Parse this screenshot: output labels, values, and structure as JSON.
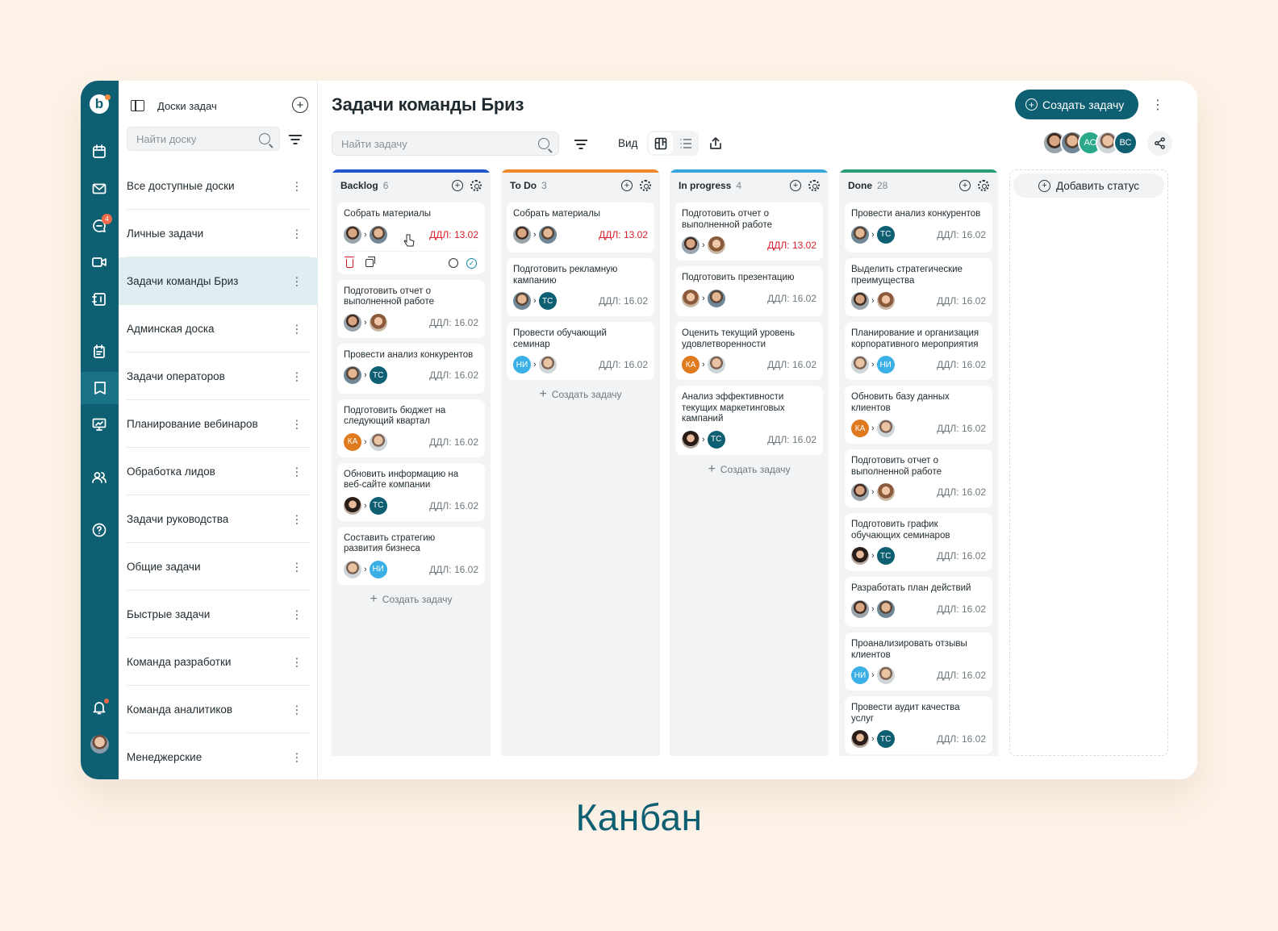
{
  "app": {
    "rail_icons": [
      "logo-icon",
      "calendar-icon",
      "mail-icon",
      "chat-icon",
      "video-icon",
      "contacts-book-icon",
      "notes-icon",
      "tasks-icon",
      "presentation-icon",
      "users-icon",
      "help-icon",
      "bell-icon"
    ],
    "chat_badge": "4"
  },
  "boards": {
    "title": "Доски задач",
    "search_placeholder": "Найти доску",
    "items": [
      {
        "label": "Все доступные доски"
      },
      {
        "label": "Личные задачи"
      },
      {
        "label": "Задачи команды Бриз",
        "active": true
      },
      {
        "label": "Админская доска"
      },
      {
        "label": "Задачи операторов"
      },
      {
        "label": "Планирование вебинаров"
      },
      {
        "label": "Обработка лидов"
      },
      {
        "label": "Задачи руководства"
      },
      {
        "label": "Общие задачи"
      },
      {
        "label": "Быстрые задачи"
      },
      {
        "label": "Команда разработки"
      },
      {
        "label": "Команда аналитиков"
      },
      {
        "label": "Менеджерские"
      }
    ]
  },
  "main": {
    "title": "Задачи команды Бриз",
    "create_label": "Создать задачу",
    "search_placeholder": "Найти задачу",
    "view_label": "Вид",
    "team": [
      {
        "type": "photo",
        "style": "m1"
      },
      {
        "type": "photo",
        "style": "m2"
      },
      {
        "type": "initials",
        "text": "АС",
        "color": "#2aa88a"
      },
      {
        "type": "photo",
        "style": "m3"
      },
      {
        "type": "initials",
        "text": "ВС",
        "color": "#0f5f72"
      }
    ]
  },
  "columns": [
    {
      "name": "Backlog",
      "count": "6",
      "color": "#1f56c9",
      "add_label": "Создать задачу",
      "cards": [
        {
          "title": "Собрать материалы",
          "from": "m1",
          "to": "m2",
          "due": "ДДЛ: 13.02",
          "overdue": true,
          "expanded": true
        },
        {
          "title": "Подготовить отчет о выполненной работе",
          "from": "m1",
          "to": "f1",
          "due": "ДДЛ: 16.02"
        },
        {
          "title": "Провести анализ конкурентов",
          "from": "m2",
          "to": "ТС",
          "due": "ДДЛ: 16.02"
        },
        {
          "title": "Подготовить бюджет на следующий квартал",
          "from": "КА",
          "to": "m3",
          "due": "ДДЛ: 16.02"
        },
        {
          "title": "Обновить информацию на веб-сайте компании",
          "from": "f2",
          "to": "ТС",
          "due": "ДДЛ: 16.02"
        },
        {
          "title": "Составить стратегию развития бизнеса",
          "from": "m3",
          "to": "НИ",
          "due": "ДДЛ: 16.02"
        }
      ]
    },
    {
      "name": "To Do",
      "count": "3",
      "color": "#f0882a",
      "add_label": "Создать задачу",
      "cards": [
        {
          "title": "Собрать материалы",
          "from": "m1",
          "to": "m2",
          "due": "ДДЛ: 13.02",
          "overdue": true
        },
        {
          "title": "Подготовить рекламную кампанию",
          "from": "m2",
          "to": "ТС",
          "due": "ДДЛ: 16.02"
        },
        {
          "title": "Провести обучающий семинар",
          "from": "НИ",
          "to": "m3",
          "due": "ДДЛ: 16.02"
        }
      ]
    },
    {
      "name": "In progress",
      "count": "4",
      "color": "#36a6dd",
      "add_label": "Создать задачу",
      "cards": [
        {
          "title": "Подготовить отчет о выполненной работе",
          "from": "m1",
          "to": "f1",
          "due": "ДДЛ: 13.02",
          "overdue": true
        },
        {
          "title": "Подготовить презентацию",
          "from": "f1",
          "to": "m2",
          "due": "ДДЛ: 16.02"
        },
        {
          "title": "Оценить текущий уровень удовлетворенности",
          "from": "КА",
          "to": "m3",
          "due": "ДДЛ: 16.02"
        },
        {
          "title": "Анализ эффективности текущих маркетинговых кампаний",
          "from": "f2",
          "to": "ТС",
          "due": "ДДЛ: 16.02"
        }
      ]
    },
    {
      "name": "Done",
      "count": "28",
      "color": "#2a9d78",
      "add_label": "",
      "cards": [
        {
          "title": "Провести анализ конкурентов",
          "from": "m2",
          "to": "ТС",
          "due": "ДДЛ: 16.02"
        },
        {
          "title": "Выделить стратегические преимущества",
          "from": "m1",
          "to": "f1",
          "due": "ДДЛ: 16.02"
        },
        {
          "title": "Планирование и организация корпоративного мероприятия",
          "from": "m3",
          "to": "НИ",
          "due": "ДДЛ: 16.02"
        },
        {
          "title": "Обновить базу данных клиентов",
          "from": "КА",
          "to": "m3",
          "due": "ДДЛ: 16.02"
        },
        {
          "title": "Подготовить отчет о выполненной работе",
          "from": "m1",
          "to": "f1",
          "due": "ДДЛ: 16.02"
        },
        {
          "title": "Подготовить график обучающих семинаров",
          "from": "f2",
          "to": "ТС",
          "due": "ДДЛ: 16.02"
        },
        {
          "title": "Разработать план действий",
          "from": "m1",
          "to": "m2",
          "due": "ДДЛ: 16.02"
        },
        {
          "title": "Проанализировать отзывы клиентов",
          "from": "НИ",
          "to": "m3",
          "due": "ДДЛ: 16.02"
        },
        {
          "title": "Провести аудит качества услуг",
          "from": "f2",
          "to": "ТС",
          "due": "ДДЛ: 16.02"
        }
      ]
    }
  ],
  "add_status_label": "Добавить статус",
  "caption": "Канбан"
}
